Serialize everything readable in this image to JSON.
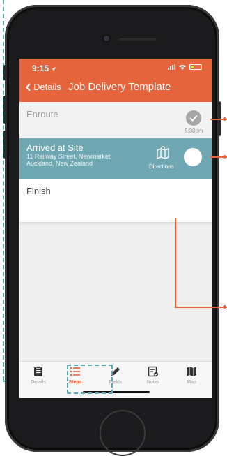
{
  "status_bar": {
    "time": "9:15"
  },
  "nav": {
    "back_label": "Details",
    "title": "Job Delivery Template"
  },
  "steps": [
    {
      "title": "Enroute",
      "time": "5:30pm",
      "state": "completed"
    },
    {
      "title": "Arrived at Site",
      "address": "11 Railway Street, Newmarket, Auckland, New Zealand",
      "action_label": "Directions",
      "state": "active"
    },
    {
      "title": "Finish",
      "state": "pending"
    }
  ],
  "tabbar": {
    "items": [
      {
        "label": "Details",
        "icon": "clipboard-icon"
      },
      {
        "label": "Steps",
        "icon": "list-icon",
        "active": true
      },
      {
        "label": "Fields",
        "icon": "pencil-icon"
      },
      {
        "label": "Notes",
        "icon": "notes-icon"
      },
      {
        "label": "Map",
        "icon": "map-icon"
      }
    ]
  },
  "colors": {
    "accent": "#e6643c",
    "active_step": "#6fa8b2",
    "guide": "#5aa9b5"
  }
}
